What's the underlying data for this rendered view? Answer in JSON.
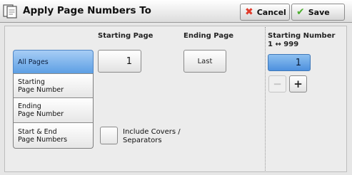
{
  "header": {
    "title": "Apply Page Numbers To",
    "cancel_label": "Cancel",
    "save_label": "Save",
    "icons": {
      "title": "document-pages-icon",
      "cancel": "red-x-icon",
      "save": "green-check-icon"
    }
  },
  "columns": {
    "starting_page": "Starting Page",
    "ending_page": "Ending Page",
    "starting_number": "Starting Number",
    "range": "1 ↔ 999"
  },
  "options": [
    {
      "label": "All Pages",
      "selected": true
    },
    {
      "label": "Starting\nPage Number",
      "selected": false
    },
    {
      "label": "Ending\nPage Number",
      "selected": false
    },
    {
      "label": "Start & End\nPage Numbers",
      "selected": false
    }
  ],
  "values": {
    "starting_page": "1",
    "ending_page": "Last",
    "starting_number": "1"
  },
  "stepper": {
    "minus": "−",
    "plus": "+"
  },
  "include_covers": {
    "label": "Include Covers /\nSeparators",
    "checked": false
  },
  "colors": {
    "selected": "#5d9fe4",
    "cancel_icon": "#e03a2a",
    "save_icon": "#4caf2e"
  }
}
